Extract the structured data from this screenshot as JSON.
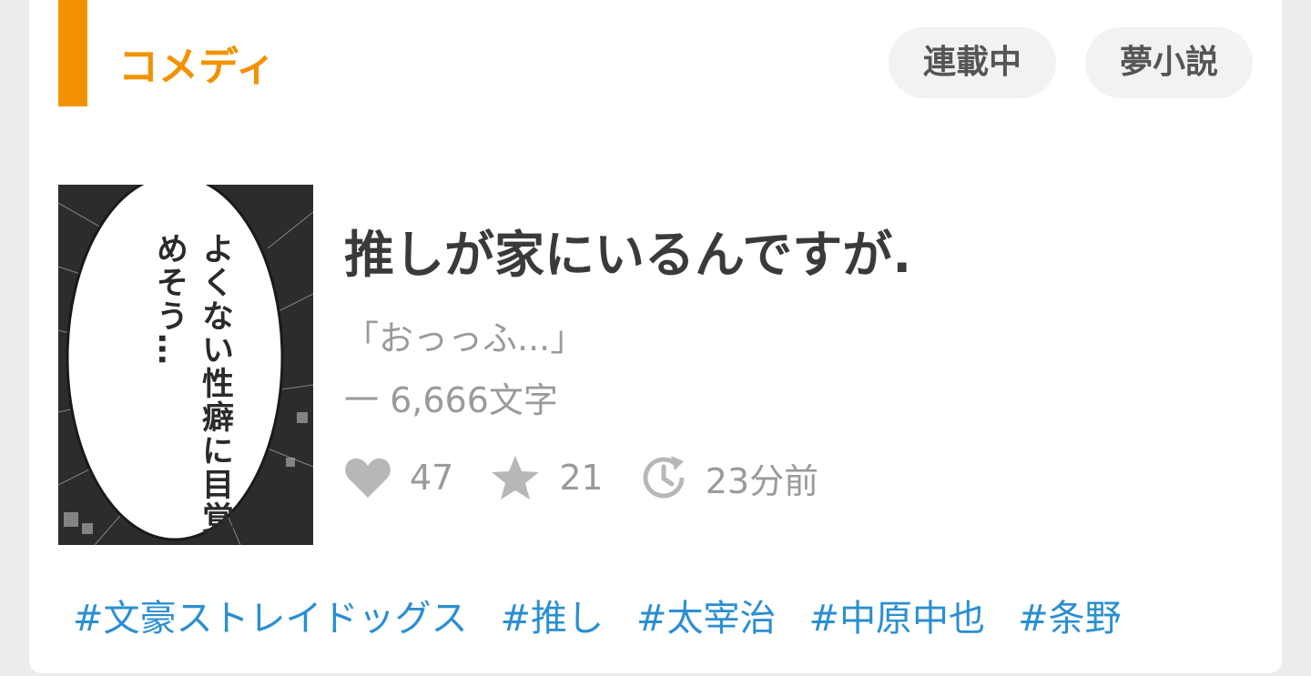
{
  "colors": {
    "accent_orange": "#f39200",
    "chip_bg": "#f2f2f2",
    "chip_text": "#555555",
    "title_text": "#3a3a3a",
    "meta_text": "#9a9a9a",
    "icon_gray": "#b9b6b6",
    "tag_blue": "#2a8fd1"
  },
  "genre": {
    "label": "コメディ"
  },
  "chips": {
    "serial": "連載中",
    "dream": "夢小説"
  },
  "cover": {
    "text": "よくない性癖に目覚めそう…"
  },
  "work": {
    "title": "推しが家にいるんですが.",
    "excerpt": "「おっっふ...」",
    "char_count": "一 6,666文字"
  },
  "stats": {
    "likes": {
      "icon": "heart-icon",
      "value": "47"
    },
    "stars": {
      "icon": "star-icon",
      "value": "21"
    },
    "updated": {
      "icon": "clock-refresh-icon",
      "value": "23分前"
    }
  },
  "tags": [
    "#文豪ストレイドッグス",
    "#推し",
    "#太宰治",
    "#中原中也",
    "#条野"
  ]
}
